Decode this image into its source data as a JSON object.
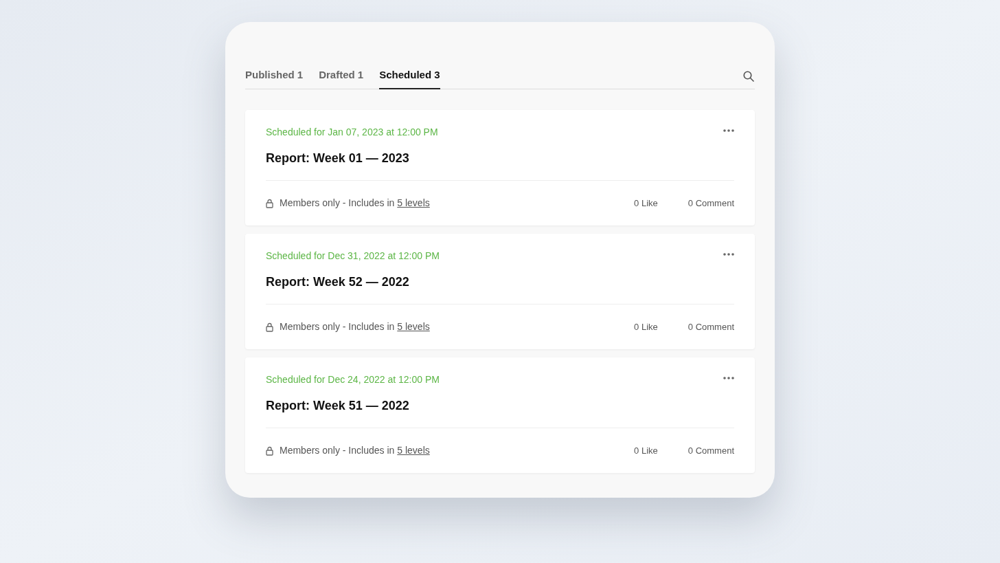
{
  "tabs": [
    {
      "label": "Published 1",
      "selected": false
    },
    {
      "label": "Drafted 1",
      "selected": false
    },
    {
      "label": "Scheduled 3",
      "selected": true
    }
  ],
  "posts": [
    {
      "schedule": "Scheduled for Jan 07, 2023 at 12:00 PM",
      "title": "Report: Week 01 — 2023",
      "access_text": "Members only - Includes in",
      "access_link": "5 levels",
      "likes": "0 Like",
      "comments": "0 Comment"
    },
    {
      "schedule": "Scheduled for Dec 31, 2022 at 12:00 PM",
      "title": "Report: Week 52 — 2022",
      "access_text": "Members only - Includes in",
      "access_link": "5 levels",
      "likes": "0 Like",
      "comments": "0 Comment"
    },
    {
      "schedule": "Scheduled for Dec 24, 2022 at 12:00 PM",
      "title": "Report: Week 51 — 2022",
      "access_text": "Members only - Includes in",
      "access_link": "5 levels",
      "likes": "0 Like",
      "comments": "0 Comment"
    }
  ]
}
